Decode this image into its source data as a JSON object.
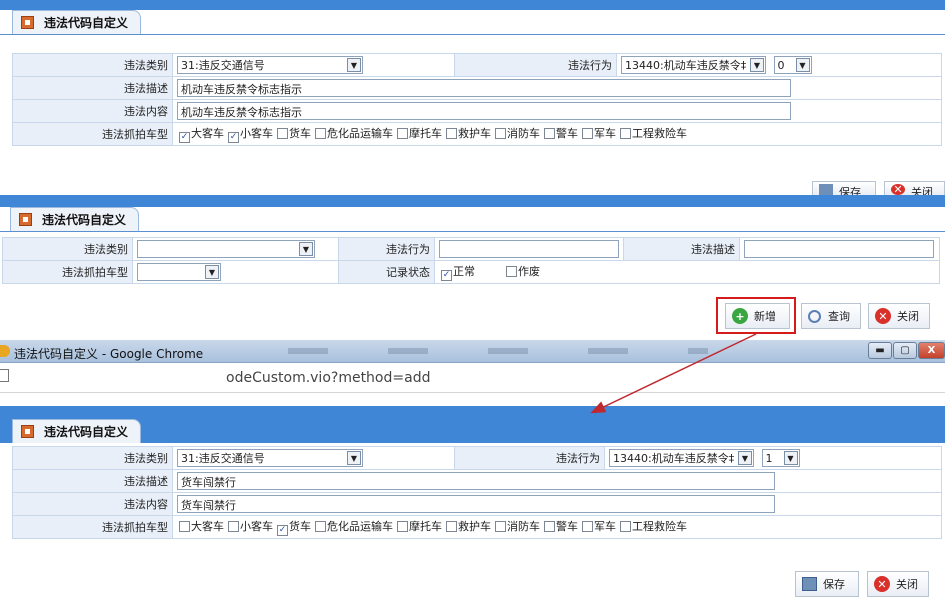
{
  "panel1": {
    "title": "违法代码自定义",
    "type_label": "违法类别",
    "type_value": "31:违反交通信号",
    "behavior_label": "违法行为",
    "behavior_value": "13440:机动车违反禁令‫",
    "behavior_value_clean": "13440:机动车违反禁令▾",
    "seq_value": "0",
    "desc_label": "违法描述",
    "desc_value": "机动车违反禁令标志指示",
    "content_label": "违法内容",
    "content_value": "机动车违反禁令标志指示",
    "vehicle_label": "违法抓拍车型",
    "vehicles": [
      {
        "label": "大客车",
        "checked": true
      },
      {
        "label": "小客车",
        "checked": true
      },
      {
        "label": "货车",
        "checked": false
      },
      {
        "label": "危化品运输车",
        "checked": false
      },
      {
        "label": "摩托车",
        "checked": false
      },
      {
        "label": "救护车",
        "checked": false
      },
      {
        "label": "消防车",
        "checked": false
      },
      {
        "label": "警车",
        "checked": false
      },
      {
        "label": "军车",
        "checked": false
      },
      {
        "label": "工程救险车",
        "checked": false
      }
    ],
    "save_label": "保存",
    "close_label": "关闭"
  },
  "panel2": {
    "title": "违法代码自定义",
    "type_label": "违法类别",
    "behavior_label": "违法行为",
    "desc_label": "违法描述",
    "vehicle_label": "违法抓拍车型",
    "status_label": "记录状态",
    "status_normal": "正常",
    "status_void": "作废",
    "add_label": "新增",
    "query_label": "查询",
    "close_label": "关闭"
  },
  "browser": {
    "title": "违法代码自定义 - Google Chrome",
    "url": "odeCustom.vio?method=add"
  },
  "panel3": {
    "title": "违法代码自定义",
    "type_label": "违法类别",
    "type_value": "31:违反交通信号",
    "behavior_label": "违法行为",
    "behavior_value": "13440:机动车违反禁令‡",
    "seq_value": "1",
    "desc_label": "违法描述",
    "desc_value": "货车闯禁行",
    "content_label": "违法内容",
    "content_value": "货车闯禁行",
    "vehicle_label": "违法抓拍车型",
    "vehicles": [
      {
        "label": "大客车",
        "checked": false
      },
      {
        "label": "小客车",
        "checked": false
      },
      {
        "label": "货车",
        "checked": true
      },
      {
        "label": "危化品运输车",
        "checked": false
      },
      {
        "label": "摩托车",
        "checked": false
      },
      {
        "label": "救护车",
        "checked": false
      },
      {
        "label": "消防车",
        "checked": false
      },
      {
        "label": "警车",
        "checked": false
      },
      {
        "label": "军车",
        "checked": false
      },
      {
        "label": "工程救险车",
        "checked": false
      }
    ],
    "save_label": "保存",
    "close_label": "关闭"
  },
  "colors": {
    "header_blue": "#3f86d6",
    "label_bg": "#e8eff8",
    "highlight": "#d51b1b",
    "arrow": "#c0282d"
  }
}
